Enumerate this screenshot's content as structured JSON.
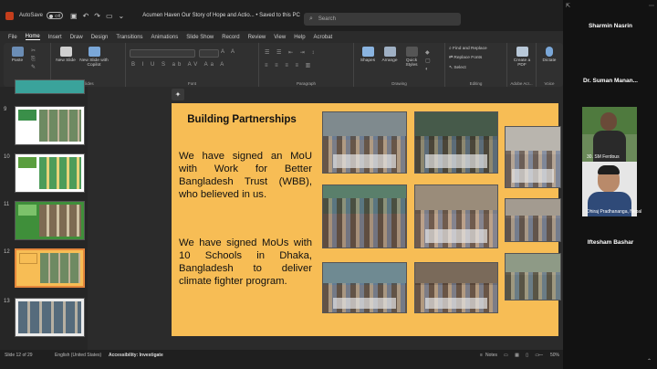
{
  "titlebar": {
    "autosave_label": "AutoSave",
    "autosave_state": "Off",
    "doc_title": "Acumen Haven Our Story of Hope and Actio...  •  Saved to this PC",
    "search_placeholder": "Search"
  },
  "menu": [
    "File",
    "Home",
    "Insert",
    "Draw",
    "Design",
    "Transitions",
    "Animations",
    "Slide Show",
    "Record",
    "Review",
    "View",
    "Help",
    "Acrobat"
  ],
  "ribbon": {
    "paste": "Paste",
    "new_slide": "New Slide",
    "new_slide_copilot": "New Slide with Copilot",
    "shapes": "Shapes",
    "arrange": "Arrange",
    "quick_styles": "Quick Styles",
    "find_replace": "Find and Replace",
    "replace_fonts": "Replace Fonts",
    "select": "Select",
    "create_pdf": "Create a PDF",
    "dictate": "Dictate",
    "groups": {
      "clipboard": "Clipboard",
      "slides": "Slides",
      "font": "Font",
      "paragraph": "Paragraph",
      "drawing": "Drawing",
      "editing": "Editing",
      "adobe": "Adobe Acr...",
      "voice": "Voice"
    }
  },
  "thumbnails": [
    {
      "num": "9"
    },
    {
      "num": "10"
    },
    {
      "num": "11"
    },
    {
      "num": "12"
    },
    {
      "num": "13"
    }
  ],
  "slide": {
    "title": "Building Partnerships",
    "para1": "We have signed an MoU with Work for Better Bangladesh Trust (WBB), who believed in us.",
    "para2": "We have signed MoUs with 10 Schools in Dhaka, Bangladesh to deliver climate fighter program."
  },
  "status": {
    "slide_info": "Slide 12 of 29",
    "language": "English (United States)",
    "accessibility": "Accessibility: Investigate",
    "notes": "Notes",
    "zoom": "50%"
  },
  "participants": {
    "p1": "Sharmin Nasrin",
    "p2": "Dr. Suman Manan...",
    "p3_label": "30. SM Ferdous",
    "p4_label": "Dhiraj Pradhananga, Nepal",
    "p5": "Iftesham Bashar"
  },
  "colors": {
    "slide_bg": "#f7bd55",
    "accent": "#e4863b",
    "app_bg": "#2b2b2b"
  }
}
